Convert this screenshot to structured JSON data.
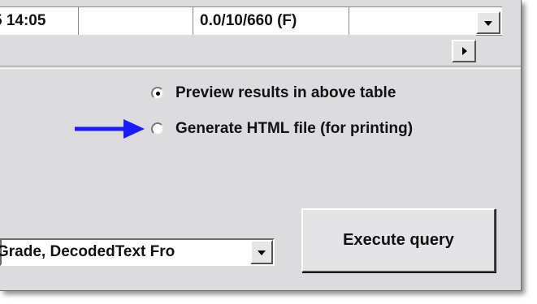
{
  "grid": {
    "row": [
      "5 14:05",
      "",
      "0.0/10/660 (F)",
      ""
    ]
  },
  "output_options": [
    {
      "label": "Preview results in above table",
      "selected": true
    },
    {
      "label": "Generate HTML file (for printing)",
      "selected": false
    }
  ],
  "query_combo": {
    "value": "Grade, DecodedText Fro"
  },
  "execute_button": {
    "label": "Execute query"
  },
  "colors": {
    "annotation_arrow": "#1a1aff",
    "background": "#dcdcde"
  },
  "icons": [
    "chevron-down-icon",
    "chevron-right-icon",
    "blue-arrow-annotation"
  ]
}
